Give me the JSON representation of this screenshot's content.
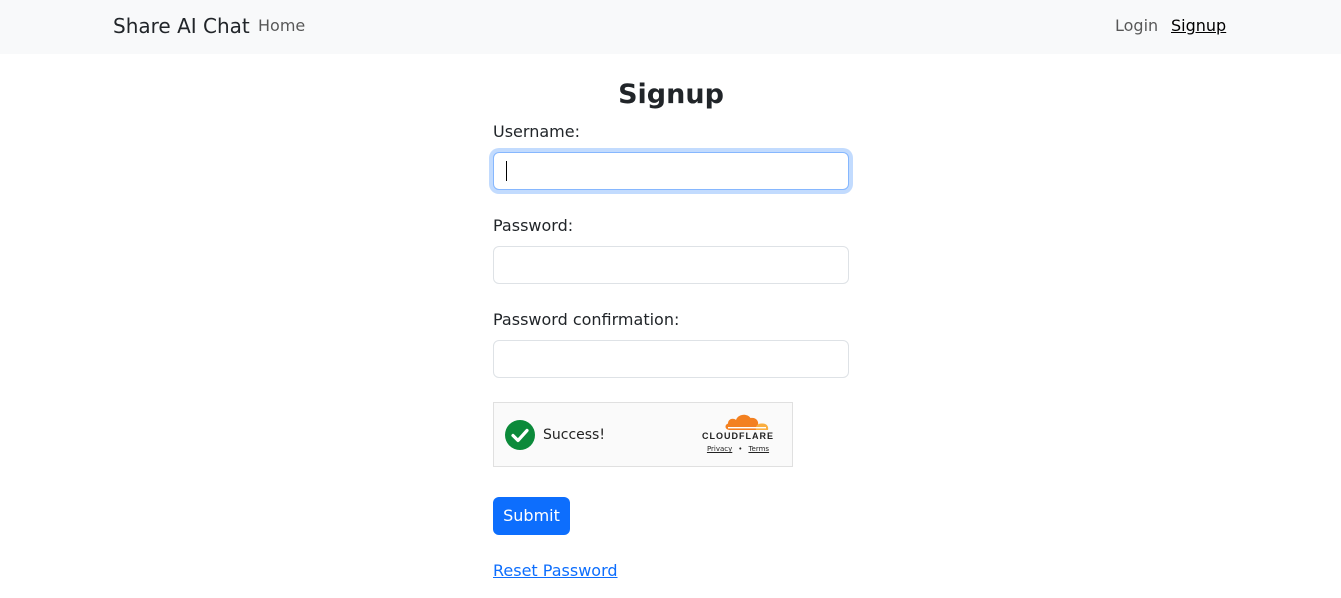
{
  "navbar": {
    "brand": "Share AI Chat",
    "links": {
      "home": "Home",
      "login": "Login",
      "signup": "Signup"
    }
  },
  "form": {
    "title": "Signup",
    "username": {
      "label": "Username:",
      "value": ""
    },
    "password": {
      "label": "Password:",
      "value": ""
    },
    "password_confirmation": {
      "label": "Password confirmation:",
      "value": ""
    },
    "submit_label": "Submit",
    "reset_link": "Reset Password"
  },
  "captcha": {
    "status": "Success!",
    "provider": "CLOUDFLARE",
    "privacy": "Privacy",
    "separator": "•",
    "terms": "Terms"
  },
  "colors": {
    "primary": "#0d6efd",
    "navbar_bg": "#f8f9fa",
    "success": "#0b8a3a",
    "cloudflare_orange": "#f38020"
  },
  "icons": {
    "captcha_status": "check-circle-icon",
    "provider_logo": "cloudflare-cloud-icon"
  }
}
